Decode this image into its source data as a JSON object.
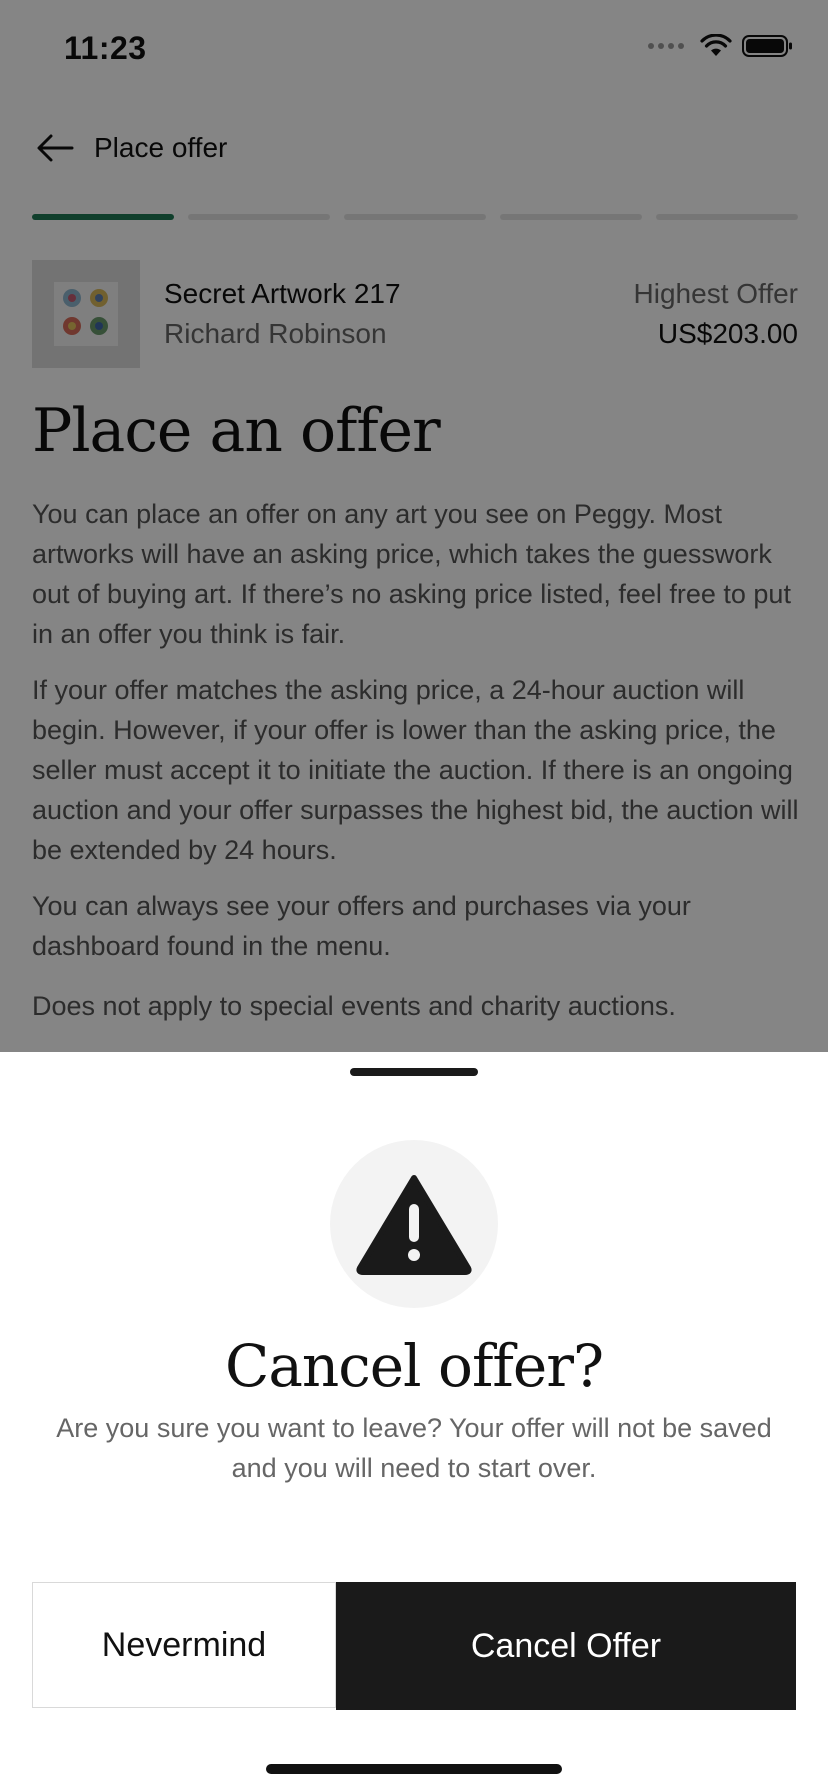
{
  "status_bar": {
    "time": "11:23"
  },
  "header": {
    "title": "Place offer"
  },
  "progress": {
    "steps_total": 5,
    "current_step": 1
  },
  "artwork": {
    "title": "Secret Artwork 217",
    "artist": "Richard Robinson",
    "offer_label": "Highest Offer",
    "offer_value": "US$203.00"
  },
  "content": {
    "heading": "Place an offer",
    "paragraphs": [
      "You can place an offer on any art you see on Peggy. Most artworks will have an asking price, which takes the guesswork out of buying art. If there’s no asking price listed, feel free to put in an offer you think is fair.",
      "If your offer matches the asking price, a 24-hour auction will begin. However, if your offer is lower than the asking price, the seller must accept it to initiate the auction. If there is an ongoing auction and your offer surpasses the highest bid, the auction will be extended by 24 hours.",
      "You can always see your offers and purchases via your dashboard found in the menu.",
      "Does not apply to special events and charity auctions."
    ]
  },
  "dialog": {
    "icon": "warning-icon",
    "title": "Cancel offer?",
    "message": "Are you sure you want to leave? Your offer will not be saved and you will need to start over.",
    "secondary_label": "Nevermind",
    "primary_label": "Cancel Offer"
  },
  "colors": {
    "accent": "#1f7a55",
    "primary_button": "#1a1a1a",
    "overlay": "rgba(0,0,0,0.48)"
  }
}
